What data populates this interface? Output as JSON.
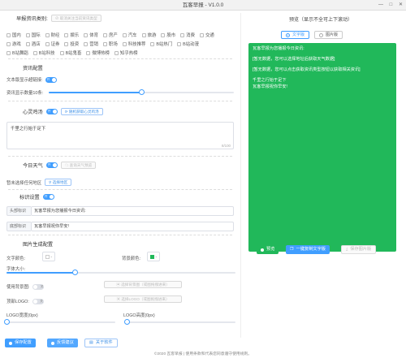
{
  "window": {
    "title": "瓦客早报 - V1.0.0",
    "min": "—",
    "max": "□",
    "close": "✕"
  },
  "news": {
    "title": "早报资讯类别:",
    "clear_label": "取消关注当前资讯类型",
    "categories_row1": [
      "国内",
      "国际",
      "财经",
      "娱乐",
      "体育",
      "房产",
      "汽车",
      "旅游",
      "股市",
      "消费",
      "交通"
    ],
    "categories_row2": [
      "游戏",
      "酒店",
      "证券",
      "投资",
      "营销",
      "职场",
      "科技推荐",
      "B站热门",
      "B站动漫"
    ],
    "categories_row3": [
      "B站舞蹈",
      "B站科技",
      "B站鬼畜",
      "微博热榜",
      "知乎热榜"
    ]
  },
  "info": {
    "title": "资讯配置",
    "show_link_label": "文本版显示超链接:",
    "show_link_toggle": "开",
    "count_label": "资讯显示数量10条:",
    "count_value": 10,
    "count_max": 20
  },
  "heart": {
    "title": "心灵鸡汤",
    "toggle": "开",
    "random_label": "随机获取心灵鸡汤",
    "text": "千里之行始于足下",
    "counter": "8/100"
  },
  "weather": {
    "title": "今日天气",
    "toggle": "开",
    "preview_label": "查询天气预览",
    "region_label": "暂未选择任何地区",
    "select_region": "选择地区"
  },
  "marker": {
    "title": "标识设置",
    "toggle": "开",
    "header_label": "头部标识",
    "header_value": "瓦客早报为您播报今日资讯:",
    "footer_label": "底部标识",
    "footer_value": "瓦客早报祝你早安!"
  },
  "image": {
    "title": "图片生成配置",
    "text_color_label": "文字颜色:",
    "bg_color_label": "背景颜色:",
    "bg_color": "#21b85a",
    "font_size_label": "字体大小:",
    "font_size_value": 30,
    "font_size_max": 100,
    "bg_image_label": "使用背景图:",
    "bg_image_toggle": "关",
    "bg_image_btn": "选择背景图（或图拖拽进来）",
    "logo_label": "顶部LOGO:",
    "logo_toggle": "关",
    "logo_btn": "选择LOGO（或图拖拽进来）",
    "logo_width_label": "LOGO宽度(0px)",
    "logo_height_label": "LOGO高度(0px)"
  },
  "actions": {
    "save": "保存配置",
    "feedback": "反馈建议",
    "about": "关于软件"
  },
  "preview": {
    "title": "预览（显示不全可上下滚动）",
    "mode_text": "文字版",
    "mode_image": "图片版",
    "line1": "瓦客早报为您播报今日资讯:",
    "line2": "[暂无数据，您可以选择地址后获取天气数据]",
    "line3": "[暂无数据，您可以点击获取资讯类型按钮以获取相关资讯]",
    "line4": "千里之行始于足下",
    "line5": "瓦客早报祝你早安!",
    "btn_preview": "预览",
    "btn_copy": "一键复制文字版",
    "btn_save_image": "保存图片版"
  },
  "footer": {
    "text": "©2020 瓦客早报 | 使用条款和代表您同意遵守使用规则。"
  },
  "colors": {
    "accent": "#409eff",
    "green": "#21b85a"
  }
}
